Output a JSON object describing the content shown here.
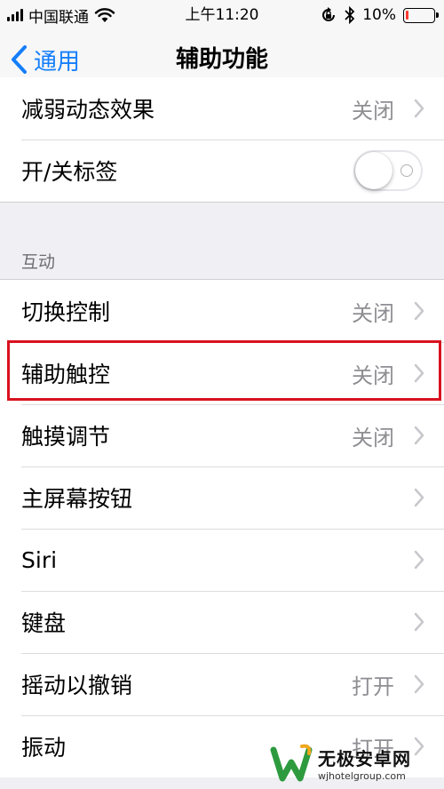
{
  "status_bar": {
    "carrier": "中国联通",
    "time": "上午11:20",
    "battery_text": "10%",
    "battery_level": 0.1,
    "battery_color": "#ff3b30"
  },
  "nav": {
    "back_label": "通用",
    "title": "辅助功能",
    "accent_color": "#147efb"
  },
  "rows_top": [
    {
      "label": "减弱动态效果",
      "value": "关闭"
    },
    {
      "label": "开/关标签",
      "toggle": false
    }
  ],
  "section_interaction": {
    "header": "互动",
    "rows": [
      {
        "label": "切换控制",
        "value": "关闭"
      },
      {
        "label": "辅助触控",
        "value": "关闭",
        "highlighted": true
      },
      {
        "label": "触摸调节",
        "value": "关闭"
      },
      {
        "label": "主屏幕按钮",
        "value": ""
      },
      {
        "label": "Siri",
        "value": ""
      },
      {
        "label": "键盘",
        "value": ""
      },
      {
        "label": "摇动以撤销",
        "value": "打开"
      },
      {
        "label": "振动",
        "value": "打开"
      }
    ]
  },
  "highlight_color": "#d9121f",
  "watermark": {
    "title": "无极安卓网",
    "url": "wjhotelgroup.com"
  }
}
